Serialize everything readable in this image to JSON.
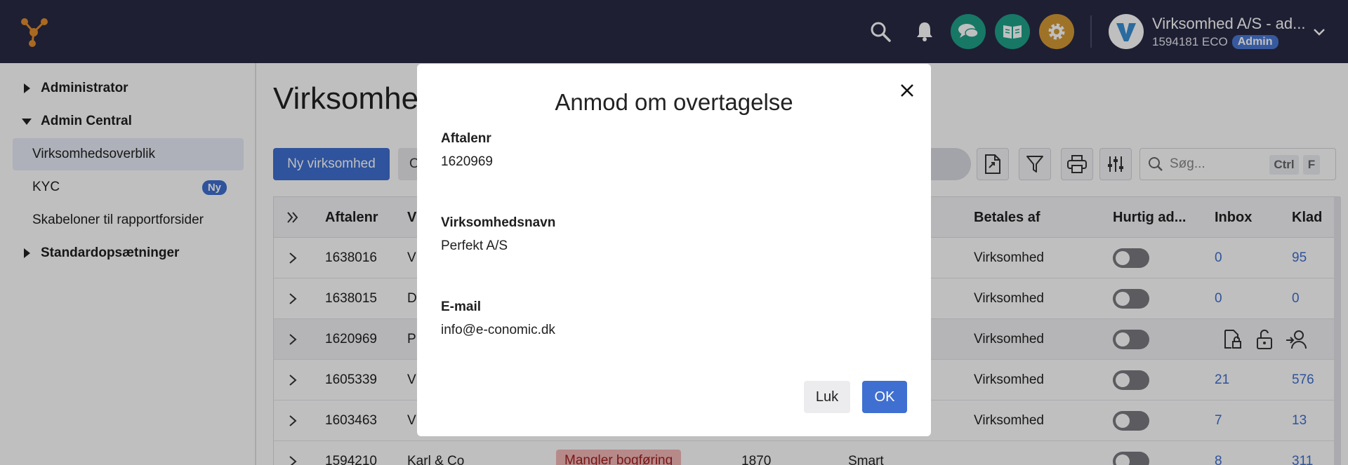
{
  "topbar": {
    "company_name": "Virksomhed A/S - ad...",
    "agreement_number": "1594181 ECO",
    "role_badge": "Admin",
    "icons": [
      "search-icon",
      "bell-icon",
      "chat-icon",
      "book-icon",
      "gear-icon"
    ],
    "colors": {
      "chat": "#1fa088",
      "book": "#1fa088",
      "gear": "#d59a34",
      "background": "#282a45"
    }
  },
  "sidebar": {
    "items": [
      {
        "label": "Administrator",
        "type": "section",
        "expanded": false
      },
      {
        "label": "Admin Central",
        "type": "section",
        "expanded": true
      },
      {
        "label": "Virksomhedsoverblik",
        "type": "link",
        "active": true
      },
      {
        "label": "KYC",
        "type": "link",
        "badge": "Ny"
      },
      {
        "label": "Skabeloner til rapportforsider",
        "type": "link"
      },
      {
        "label": "Standardopsætninger",
        "type": "section",
        "expanded": false
      }
    ]
  },
  "main": {
    "title": "Virksomhed",
    "new_company_button": "Ny virksomhed",
    "secondary_button": "O",
    "search_placeholder": "Søg...",
    "shortcut_keys": [
      "Ctrl",
      "F"
    ]
  },
  "table": {
    "headers": [
      "Aftalenr",
      "V",
      "Betales af",
      "Hurtig ad...",
      "Inbox",
      "Klad"
    ],
    "rows": [
      {
        "aftalenr": "1638016",
        "name": "V",
        "betales_af": "Virksomhed",
        "inbox": "0",
        "kladde": "95"
      },
      {
        "aftalenr": "1638015",
        "name": "D",
        "betales_af": "Virksomhed",
        "inbox": "0",
        "kladde": "0"
      },
      {
        "aftalenr": "1620969",
        "name": "P",
        "betales_af": "Virksomhed",
        "inbox": "",
        "kladde": ""
      },
      {
        "aftalenr": "1605339",
        "name": "V",
        "betales_af": "Virksomhed",
        "inbox": "21",
        "kladde": "576"
      },
      {
        "aftalenr": "1603463",
        "name": "V",
        "betales_af": "Virksomhed",
        "inbox": "7",
        "kladde": "13"
      },
      {
        "aftalenr": "1594210",
        "name": "Karl & Co",
        "status": "Mangler bogføring",
        "number": "1870",
        "plan": "Smart",
        "inbox": "8",
        "kladde": "311"
      }
    ]
  },
  "modal": {
    "title": "Anmod om overtagelse",
    "fields": [
      {
        "label": "Aftalenr",
        "value": "1620969"
      },
      {
        "label": "Virksomhedsnavn",
        "value": "Perfekt A/S"
      },
      {
        "label": "E-mail",
        "value": "info@e-conomic.dk"
      }
    ],
    "cancel_label": "Luk",
    "ok_label": "OK"
  }
}
